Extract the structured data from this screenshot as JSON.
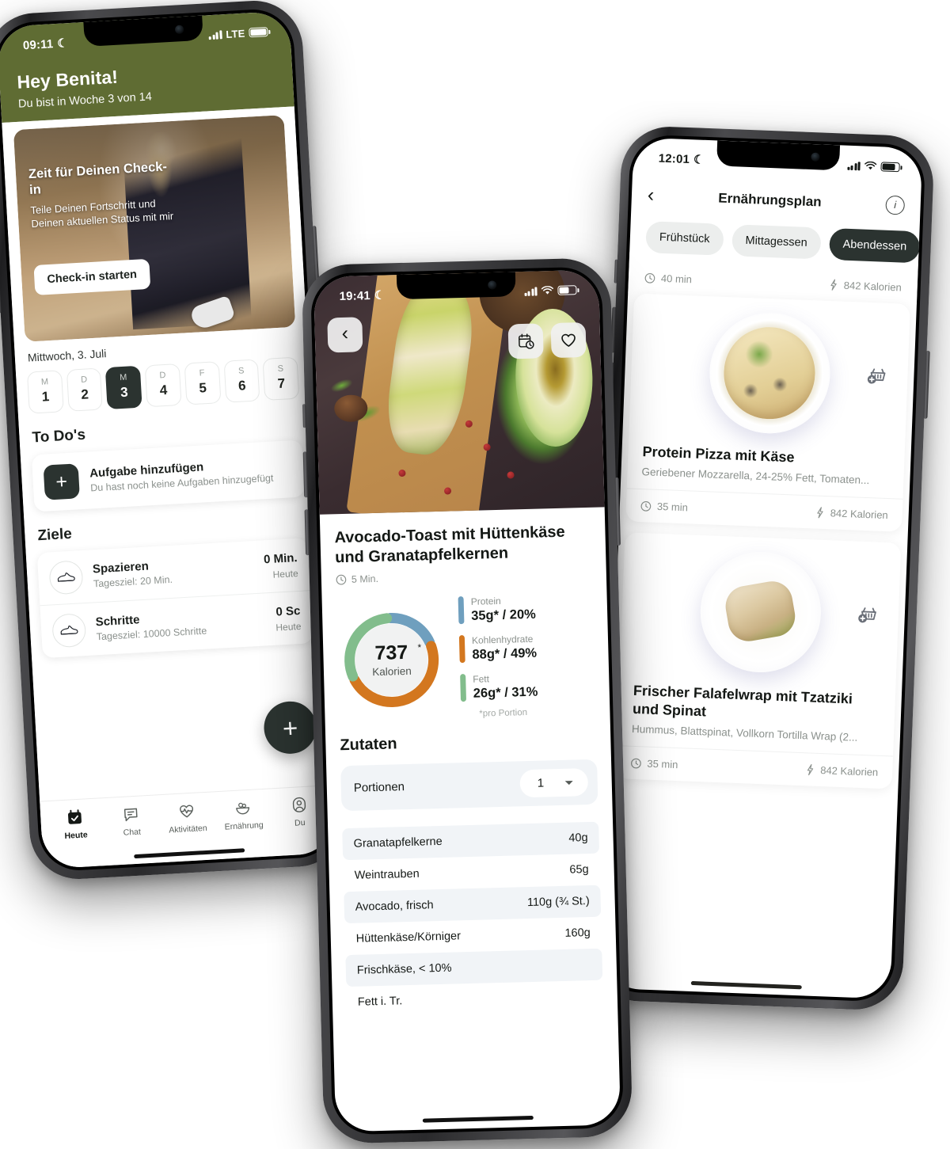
{
  "app": {
    "accent_olive": "#5f6c33",
    "accent_dark": "#2b3330"
  },
  "phone1": {
    "status": {
      "time": "09:11",
      "moon": "☾",
      "network": "LTE"
    },
    "header": {
      "greeting": "Hey Benita!",
      "subtitle": "Du bist in Woche 3 von 14"
    },
    "hero": {
      "title": "Zeit für Deinen Check-in",
      "description": "Teile Deinen Fortschritt und Deinen aktuellen Status mit mir",
      "button": "Check-in starten"
    },
    "date_label": "Mittwoch, 3. Juli",
    "days": [
      {
        "letter": "M",
        "num": "1",
        "active": false
      },
      {
        "letter": "D",
        "num": "2",
        "active": false
      },
      {
        "letter": "M",
        "num": "3",
        "active": true
      },
      {
        "letter": "D",
        "num": "4",
        "active": false
      },
      {
        "letter": "F",
        "num": "5",
        "active": false
      },
      {
        "letter": "S",
        "num": "6",
        "active": false
      },
      {
        "letter": "S",
        "num": "7",
        "active": false
      }
    ],
    "todos": {
      "section_title": "To Do's",
      "add_title": "Aufgabe hinzufügen",
      "add_subtitle": "Du hast noch keine Aufgaben hinzugefügt"
    },
    "goals": {
      "section_title": "Ziele",
      "items": [
        {
          "title": "Spazieren",
          "subtitle": "Tagesziel: 20 Min.",
          "value": "0 Min.",
          "when": "Heute"
        },
        {
          "title": "Schritte",
          "subtitle": "Tagesziel: 10000 Schritte",
          "value": "0 Sc",
          "when": "Heute"
        }
      ]
    },
    "fab": "+",
    "tabs": [
      {
        "label": "Heute",
        "icon": "calendar-check-icon",
        "active": true
      },
      {
        "label": "Chat",
        "icon": "chat-bubble-icon",
        "active": false
      },
      {
        "label": "Aktivitäten",
        "icon": "heart-pulse-icon",
        "active": false
      },
      {
        "label": "Ernährung",
        "icon": "salad-bowl-icon",
        "active": false
      },
      {
        "label": "Du",
        "icon": "person-icon",
        "active": false
      }
    ]
  },
  "phone2": {
    "status": {
      "time": "19:41",
      "moon": "☾"
    },
    "recipe": {
      "title": "Avocado-Toast mit Hüttenkäse und Granatapfelkernen",
      "time": "5 Min."
    },
    "actions": {
      "back": "‹",
      "schedule": "calendar-clock-icon",
      "favorite": "heart-icon"
    },
    "nutrition": {
      "calories": "737",
      "calories_label": "Kalorien",
      "star": "*",
      "footnote": "*pro Portion",
      "macros": [
        {
          "name": "Protein",
          "value": "35g* / 20%",
          "color": "#6f9fbe"
        },
        {
          "name": "Kohlenhydrate",
          "value": "88g* / 49%",
          "color": "#d3771f"
        },
        {
          "name": "Fett",
          "value": "26g* / 31%",
          "color": "#82bd8c"
        }
      ]
    },
    "ingredients": {
      "section_title": "Zutaten",
      "portions_label": "Portionen",
      "portions_value": "1",
      "items": [
        {
          "name": "Granatapfelkerne",
          "amount": "40g"
        },
        {
          "name": "Weintrauben",
          "amount": "65g"
        },
        {
          "name": "Avocado, frisch",
          "amount": "110g (¾ St.)"
        },
        {
          "name": "Hüttenkäse/Körniger",
          "amount": "160g"
        },
        {
          "name": "Frischkäse, < 10%",
          "amount": ""
        },
        {
          "name": "Fett i. Tr.",
          "amount": ""
        }
      ]
    }
  },
  "phone3": {
    "status": {
      "time": "12:01",
      "moon": "☾"
    },
    "nav": {
      "back": "‹",
      "title": "Ernährungsplan",
      "info": "i"
    },
    "chips": [
      {
        "label": "Frühstück",
        "active": false
      },
      {
        "label": "Mittagessen",
        "active": false
      },
      {
        "label": "Abendessen",
        "active": true
      }
    ],
    "top_meta": {
      "time": "40 min",
      "calories": "842 Kalorien"
    },
    "meals": [
      {
        "title": "Protein Pizza mit Käse",
        "subtitle": "Geriebener Mozzarella, 24-25% Fett, Tomaten...",
        "time": "35 min",
        "calories": "842 Kalorien",
        "cart_icon": "basket-plus-icon"
      },
      {
        "title": "Frischer Falafelwrap mit Tzatziki und Spinat",
        "subtitle": "Hummus, Blattspinat, Vollkorn Tortilla Wrap (2...",
        "time": "35 min",
        "calories": "842 Kalorien",
        "cart_icon": "basket-plus-icon"
      }
    ]
  }
}
